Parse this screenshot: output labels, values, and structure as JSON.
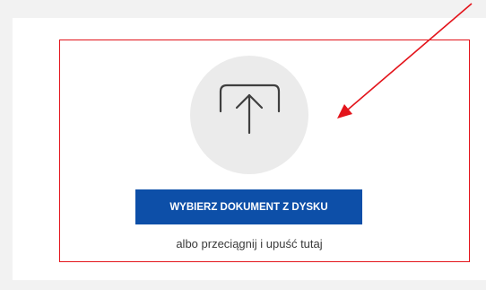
{
  "upload": {
    "icon": "upload-icon",
    "button_label": "WYBIERZ DOKUMENT Z DYSKU",
    "drop_hint": "albo przeciągnij i upuść tutaj"
  },
  "annotation": {
    "highlight_color": "#e3141b",
    "arrow_icon": "red-arrow-icon"
  },
  "colors": {
    "button_background": "#0d4fa8",
    "button_text": "#ffffff",
    "circle_background": "#ebebeb",
    "page_background": "#f2f2f2"
  }
}
